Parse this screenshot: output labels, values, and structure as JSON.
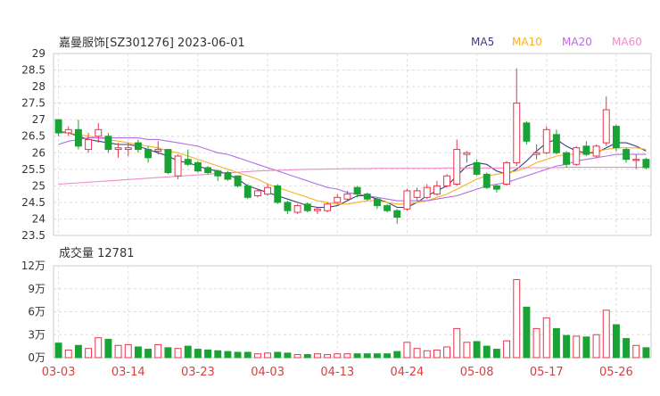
{
  "chart_data": [
    {
      "type": "candlestick",
      "title": "嘉曼服饰[SZ301276] 2023-06-01",
      "legend": [
        {
          "name": "MA5",
          "color": "#3c3c7a"
        },
        {
          "name": "MA10",
          "color": "#f5b225"
        },
        {
          "name": "MA20",
          "color": "#b56fe0"
        },
        {
          "name": "MA60",
          "color": "#ee8cc8"
        }
      ],
      "y_ticks": [
        "29",
        "28.5",
        "28",
        "27.5",
        "27",
        "26.5",
        "26",
        "25.5",
        "25",
        "24.5",
        "24",
        "23.5"
      ],
      "ylim": [
        23.5,
        29
      ],
      "x_ticks": [
        {
          "label": "03-03",
          "index": 0
        },
        {
          "label": "03-14",
          "index": 7
        },
        {
          "label": "03-23",
          "index": 14
        },
        {
          "label": "04-03",
          "index": 21
        },
        {
          "label": "04-13",
          "index": 28
        },
        {
          "label": "04-24",
          "index": 35
        },
        {
          "label": "05-08",
          "index": 42
        },
        {
          "label": "05-17",
          "index": 49
        },
        {
          "label": "05-26",
          "index": 56
        }
      ],
      "up_color": "#e8334a",
      "down_color": "#1aa335",
      "candles": [
        {
          "o": 26.6,
          "c": 27.0,
          "h": 27.0,
          "l": 26.5,
          "dir": "down"
        },
        {
          "o": 26.6,
          "c": 26.7,
          "h": 26.8,
          "l": 26.5,
          "dir": "up"
        },
        {
          "o": 26.7,
          "c": 26.2,
          "h": 27.0,
          "l": 26.1,
          "dir": "down"
        },
        {
          "o": 26.1,
          "c": 26.4,
          "h": 26.6,
          "l": 26.0,
          "dir": "up"
        },
        {
          "o": 26.5,
          "c": 26.7,
          "h": 26.9,
          "l": 26.3,
          "dir": "up"
        },
        {
          "o": 26.5,
          "c": 26.1,
          "h": 26.6,
          "l": 26.0,
          "dir": "down"
        },
        {
          "o": 26.1,
          "c": 26.15,
          "h": 26.3,
          "l": 25.85,
          "dir": "up"
        },
        {
          "o": 26.1,
          "c": 26.15,
          "h": 26.3,
          "l": 25.9,
          "dir": "up"
        },
        {
          "o": 26.3,
          "c": 26.1,
          "h": 26.4,
          "l": 26.0,
          "dir": "down"
        },
        {
          "o": 26.1,
          "c": 25.85,
          "h": 26.2,
          "l": 25.7,
          "dir": "down"
        },
        {
          "o": 26.05,
          "c": 26.1,
          "h": 26.35,
          "l": 25.95,
          "dir": "up"
        },
        {
          "o": 26.1,
          "c": 25.4,
          "h": 26.1,
          "l": 25.35,
          "dir": "down"
        },
        {
          "o": 25.3,
          "c": 25.9,
          "h": 25.95,
          "l": 25.2,
          "dir": "up"
        },
        {
          "o": 25.8,
          "c": 25.65,
          "h": 26.1,
          "l": 25.6,
          "dir": "down"
        },
        {
          "o": 25.7,
          "c": 25.45,
          "h": 25.75,
          "l": 25.4,
          "dir": "down"
        },
        {
          "o": 25.55,
          "c": 25.4,
          "h": 25.6,
          "l": 25.35,
          "dir": "down"
        },
        {
          "o": 25.45,
          "c": 25.3,
          "h": 25.5,
          "l": 25.15,
          "dir": "down"
        },
        {
          "o": 25.4,
          "c": 25.2,
          "h": 25.45,
          "l": 25.15,
          "dir": "down"
        },
        {
          "o": 25.3,
          "c": 25.0,
          "h": 25.3,
          "l": 24.95,
          "dir": "down"
        },
        {
          "o": 25.0,
          "c": 24.65,
          "h": 25.05,
          "l": 24.6,
          "dir": "down"
        },
        {
          "o": 24.7,
          "c": 24.85,
          "h": 24.9,
          "l": 24.65,
          "dir": "up"
        },
        {
          "o": 24.75,
          "c": 24.95,
          "h": 25.05,
          "l": 24.7,
          "dir": "up"
        },
        {
          "o": 25.0,
          "c": 24.5,
          "h": 25.05,
          "l": 24.45,
          "dir": "down"
        },
        {
          "o": 24.5,
          "c": 24.25,
          "h": 24.55,
          "l": 24.15,
          "dir": "down"
        },
        {
          "o": 24.2,
          "c": 24.4,
          "h": 24.45,
          "l": 24.15,
          "dir": "up"
        },
        {
          "o": 24.45,
          "c": 24.25,
          "h": 24.5,
          "l": 24.2,
          "dir": "down"
        },
        {
          "o": 24.25,
          "c": 24.3,
          "h": 24.35,
          "l": 24.15,
          "dir": "up"
        },
        {
          "o": 24.25,
          "c": 24.45,
          "h": 24.5,
          "l": 24.2,
          "dir": "up"
        },
        {
          "o": 24.5,
          "c": 24.65,
          "h": 24.75,
          "l": 24.45,
          "dir": "up"
        },
        {
          "o": 24.6,
          "c": 24.75,
          "h": 24.85,
          "l": 24.55,
          "dir": "up"
        },
        {
          "o": 24.95,
          "c": 24.75,
          "h": 25.0,
          "l": 24.65,
          "dir": "down"
        },
        {
          "o": 24.75,
          "c": 24.6,
          "h": 24.8,
          "l": 24.55,
          "dir": "down"
        },
        {
          "o": 24.6,
          "c": 24.4,
          "h": 24.65,
          "l": 24.3,
          "dir": "down"
        },
        {
          "o": 24.4,
          "c": 24.25,
          "h": 24.45,
          "l": 24.2,
          "dir": "down"
        },
        {
          "o": 24.25,
          "c": 24.05,
          "h": 24.3,
          "l": 23.85,
          "dir": "down"
        },
        {
          "o": 24.3,
          "c": 24.85,
          "h": 24.9,
          "l": 24.25,
          "dir": "up"
        },
        {
          "o": 24.65,
          "c": 24.85,
          "h": 24.95,
          "l": 24.55,
          "dir": "up"
        },
        {
          "o": 24.65,
          "c": 24.95,
          "h": 25.05,
          "l": 24.6,
          "dir": "up"
        },
        {
          "o": 24.75,
          "c": 25.0,
          "h": 25.15,
          "l": 24.7,
          "dir": "up"
        },
        {
          "o": 25.0,
          "c": 25.3,
          "h": 25.35,
          "l": 24.95,
          "dir": "up"
        },
        {
          "o": 25.05,
          "c": 26.1,
          "h": 26.4,
          "l": 25.0,
          "dir": "up"
        },
        {
          "o": 25.95,
          "c": 26.0,
          "h": 26.05,
          "l": 25.7,
          "dir": "up"
        },
        {
          "o": 25.7,
          "c": 25.35,
          "h": 25.8,
          "l": 25.3,
          "dir": "down"
        },
        {
          "o": 25.35,
          "c": 24.95,
          "h": 25.4,
          "l": 24.9,
          "dir": "down"
        },
        {
          "o": 25.0,
          "c": 24.9,
          "h": 25.05,
          "l": 24.8,
          "dir": "down"
        },
        {
          "o": 25.05,
          "c": 25.7,
          "h": 25.75,
          "l": 25.0,
          "dir": "up"
        },
        {
          "o": 25.7,
          "c": 27.5,
          "h": 28.55,
          "l": 25.6,
          "dir": "up"
        },
        {
          "o": 26.9,
          "c": 26.35,
          "h": 26.95,
          "l": 26.25,
          "dir": "down"
        },
        {
          "o": 25.95,
          "c": 26.0,
          "h": 26.25,
          "l": 25.8,
          "dir": "up"
        },
        {
          "o": 26.0,
          "c": 26.7,
          "h": 26.8,
          "l": 25.95,
          "dir": "up"
        },
        {
          "o": 26.55,
          "c": 26.0,
          "h": 26.7,
          "l": 25.95,
          "dir": "down"
        },
        {
          "o": 26.0,
          "c": 25.65,
          "h": 26.05,
          "l": 25.55,
          "dir": "down"
        },
        {
          "o": 25.65,
          "c": 26.15,
          "h": 26.2,
          "l": 25.6,
          "dir": "up"
        },
        {
          "o": 26.2,
          "c": 25.95,
          "h": 26.35,
          "l": 25.9,
          "dir": "down"
        },
        {
          "o": 25.9,
          "c": 26.2,
          "h": 26.25,
          "l": 25.85,
          "dir": "up"
        },
        {
          "o": 26.3,
          "c": 27.3,
          "h": 27.7,
          "l": 26.2,
          "dir": "up"
        },
        {
          "o": 26.8,
          "c": 26.15,
          "h": 26.85,
          "l": 26.05,
          "dir": "down"
        },
        {
          "o": 26.1,
          "c": 25.8,
          "h": 26.15,
          "l": 25.7,
          "dir": "down"
        },
        {
          "o": 25.8,
          "c": 25.8,
          "h": 25.95,
          "l": 25.5,
          "dir": "up"
        },
        {
          "o": 25.8,
          "c": 25.55,
          "h": 25.85,
          "l": 25.5,
          "dir": "down"
        }
      ],
      "ma5": [
        26.65,
        26.6,
        26.5,
        26.4,
        26.35,
        26.3,
        26.25,
        26.25,
        26.2,
        26.1,
        26.0,
        25.9,
        25.75,
        25.7,
        25.6,
        25.5,
        25.45,
        25.35,
        25.2,
        25.0,
        24.9,
        24.8,
        24.7,
        24.6,
        24.5,
        24.4,
        24.35,
        24.35,
        24.4,
        24.55,
        24.7,
        24.7,
        24.6,
        24.5,
        24.35,
        24.35,
        24.5,
        24.7,
        24.85,
        25.0,
        25.3,
        25.6,
        25.7,
        25.65,
        25.45,
        25.35,
        25.5,
        25.75,
        26.05,
        26.3,
        26.4,
        26.2,
        26.05,
        26.0,
        26.0,
        26.15,
        26.3,
        26.3,
        26.2,
        26.05
      ],
      "ma10": [
        26.6,
        26.6,
        26.55,
        26.5,
        26.45,
        26.4,
        26.35,
        26.3,
        26.25,
        26.2,
        26.15,
        26.05,
        26.0,
        25.9,
        25.8,
        25.7,
        25.6,
        25.5,
        25.4,
        25.3,
        25.2,
        25.05,
        24.95,
        24.85,
        24.75,
        24.65,
        24.55,
        24.5,
        24.45,
        24.45,
        24.5,
        24.55,
        24.55,
        24.5,
        24.45,
        24.45,
        24.5,
        24.55,
        24.65,
        24.75,
        24.9,
        25.05,
        25.2,
        25.3,
        25.35,
        25.4,
        25.45,
        25.55,
        25.7,
        25.8,
        25.9,
        25.95,
        25.95,
        26.0,
        26.05,
        26.1,
        26.15,
        26.15,
        26.15,
        26.1
      ],
      "ma20": [
        26.25,
        26.35,
        26.4,
        26.45,
        26.45,
        26.45,
        26.45,
        26.45,
        26.45,
        26.4,
        26.4,
        26.35,
        26.3,
        26.25,
        26.2,
        26.1,
        26.0,
        25.95,
        25.85,
        25.75,
        25.65,
        25.55,
        25.45,
        25.35,
        25.25,
        25.15,
        25.05,
        24.95,
        24.9,
        24.8,
        24.75,
        24.7,
        24.65,
        24.6,
        24.55,
        24.55,
        24.55,
        24.55,
        24.6,
        24.65,
        24.7,
        24.8,
        24.9,
        25.0,
        25.05,
        25.1,
        25.2,
        25.3,
        25.4,
        25.5,
        25.6,
        25.65,
        25.75,
        25.8,
        25.85,
        25.9,
        25.95,
        25.95,
        25.95,
        25.95
      ],
      "ma60": [
        25.05,
        25.07,
        25.09,
        25.11,
        25.13,
        25.15,
        25.17,
        25.19,
        25.21,
        25.23,
        25.25,
        25.27,
        25.29,
        25.31,
        25.33,
        25.35,
        25.37,
        25.39,
        25.41,
        25.43,
        25.45,
        25.46,
        25.47,
        25.48,
        25.49,
        25.5,
        25.5,
        25.51,
        25.51,
        25.52,
        25.52,
        25.52,
        25.53,
        25.53,
        25.53,
        25.53,
        25.53,
        25.53,
        25.53,
        25.54,
        25.54,
        25.54,
        25.54,
        25.54,
        25.54,
        25.54,
        25.55,
        25.55,
        25.55,
        25.55,
        25.55,
        25.56,
        25.56,
        25.56,
        25.56,
        25.56,
        25.56,
        25.56,
        25.56,
        25.56
      ]
    },
    {
      "type": "bar",
      "title": "成交量 12781",
      "unit": "万",
      "y_ticks": [
        "12万",
        "9万",
        "6万",
        "3万",
        "0万"
      ],
      "ylim": [
        0,
        12
      ],
      "volumes": [
        1.9,
        1.0,
        1.6,
        1.2,
        2.6,
        2.4,
        1.6,
        1.7,
        1.4,
        1.1,
        1.7,
        1.3,
        1.2,
        1.5,
        1.1,
        1.0,
        0.9,
        0.8,
        0.7,
        0.7,
        0.5,
        0.6,
        0.7,
        0.6,
        0.4,
        0.4,
        0.5,
        0.4,
        0.5,
        0.5,
        0.5,
        0.5,
        0.5,
        0.5,
        0.8,
        2.0,
        1.2,
        0.9,
        1.0,
        1.4,
        3.8,
        2.0,
        2.1,
        1.5,
        1.1,
        2.2,
        10.2,
        6.6,
        3.8,
        5.2,
        3.8,
        2.9,
        2.8,
        2.7,
        3.0,
        6.2,
        4.3,
        2.5,
        1.6,
        1.3
      ]
    }
  ]
}
